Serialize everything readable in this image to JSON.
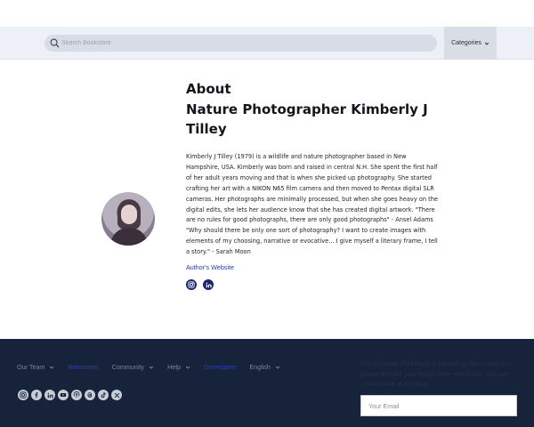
{
  "header": {
    "search_placeholder": "Search Bookstore",
    "categories_label": "Categories"
  },
  "author": {
    "heading_line1": "About",
    "heading_line2": "Nature Photographer Kimberly J",
    "heading_line3": "Tilley",
    "bio": "Kimberly J Tilley (1979) is a wildlife and nature photographer based in New Hampshire, USA. Kimberly was born and raised in central N.H. She spent the first half of her adult years moving and that is when she picked up photography. She started crafting her art with a NIKON N65 film camera and then moved to Pentax digital SLR cameras. Her photographs are minimally processed, but when she goes heavy on the digital edits, she lets her audience know that she has created digital artwork. \"There are no rules for good photographs, there are only good photographs\" - Ansel Adams \"Why should there be only one sort of photography? I want to create images with elements of my choosing, narrative or evocative... I give myself a literary frame, I tell a story.\" - Sarah Moon",
    "website_label": "Author's Website",
    "social_icons": [
      "instagram-icon",
      "linkedin-icon"
    ]
  },
  "footer": {
    "nav": [
      {
        "label": "Our Team",
        "dropdown": true
      },
      {
        "label": "Newsroom",
        "dropdown": false
      },
      {
        "label": "Community",
        "dropdown": true
      },
      {
        "label": "Help",
        "dropdown": true
      },
      {
        "label": "Developers",
        "dropdown": false
      },
      {
        "label": "English",
        "dropdown": true
      }
    ],
    "newsletter_text": "Get exclusive Publishing & Marketing tips to help you create and sell your books more effectively. You can unsubscribe at any time.",
    "email_placeholder": "Your Email",
    "social_icons": [
      "instagram-icon",
      "facebook-icon",
      "linkedin-icon",
      "youtube-icon",
      "podcast-icon",
      "threads-icon",
      "tiktok-icon",
      "x-icon"
    ]
  },
  "colors": {
    "header_bg": "#edf0f6",
    "footer_bg": "#16233a",
    "link": "#2b3a9b"
  }
}
